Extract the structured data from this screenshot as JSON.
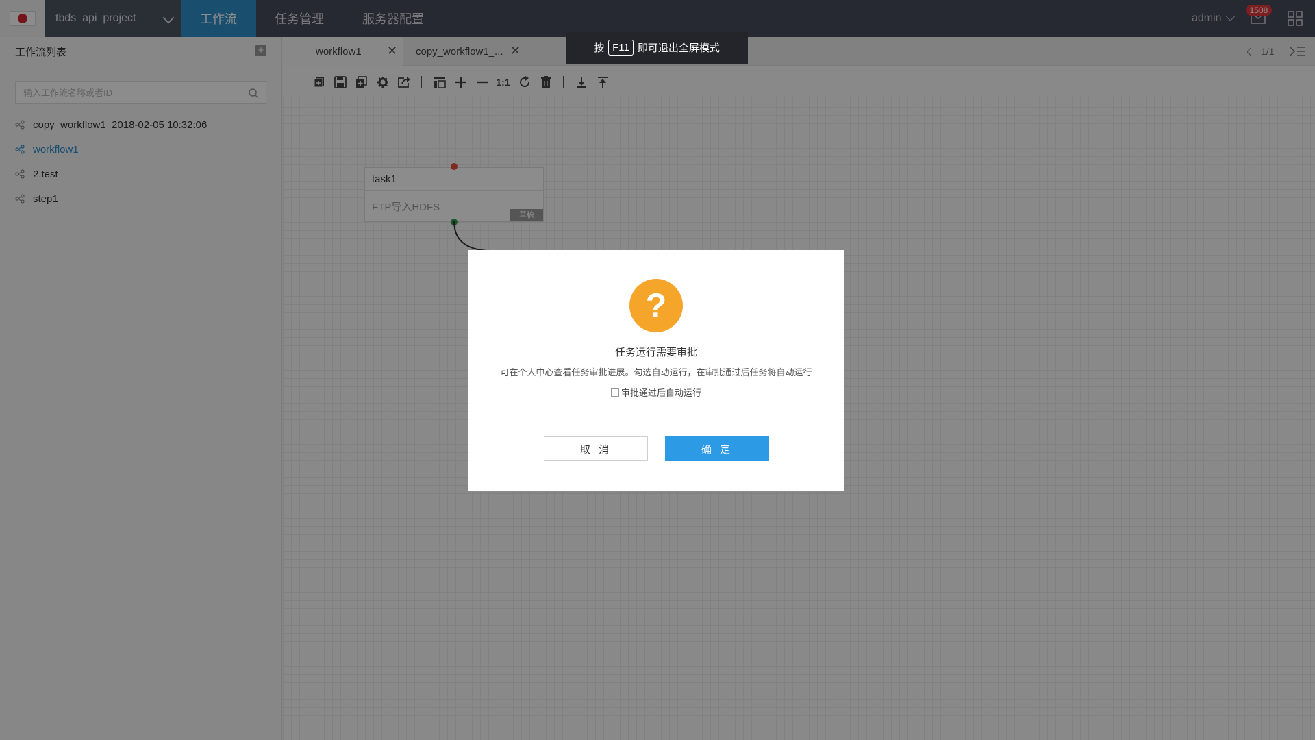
{
  "colors": {
    "nav_bg": "#464c5a",
    "nav_active": "#2f8fc9",
    "accent_blue": "#2d9ae6",
    "warning": "#f4a52a",
    "badge_red": "#e4393c"
  },
  "topbar": {
    "project": "tbds_api_project",
    "nav": [
      {
        "label": "工作流",
        "active": true
      },
      {
        "label": "任务管理",
        "active": false
      },
      {
        "label": "服务器配置",
        "active": false
      }
    ],
    "user": "admin",
    "mail_badge": "1508"
  },
  "sidebar": {
    "title": "工作流列表",
    "search_placeholder": "输入工作流名称或者ID",
    "items": [
      {
        "label": "copy_workflow1_2018-02-05 10:32:06",
        "active": false
      },
      {
        "label": "workflow1",
        "active": true
      },
      {
        "label": "2.test",
        "active": false
      },
      {
        "label": "step1",
        "active": false
      }
    ]
  },
  "tabs": [
    {
      "label": "workflow1",
      "active": true
    },
    {
      "label": "copy_workflow1_...",
      "active": false
    }
  ],
  "pager": "1/1",
  "toolbar_icons": [
    "add-icon",
    "save-icon",
    "copy-icon",
    "settings-icon",
    "export-icon",
    "layout-icon",
    "zoom-in-icon",
    "zoom-out-icon",
    "actual-size-icon",
    "refresh-icon",
    "delete-icon",
    "download-icon",
    "upload-icon"
  ],
  "toolbar": {
    "actual_size": "1:1"
  },
  "node": {
    "title": "task1",
    "desc": "FTP导入HDFS",
    "badge": "草稿"
  },
  "f11_banner": {
    "pre": "按",
    "key": "F11",
    "post": "即可退出全屏模式"
  },
  "modal": {
    "title": "任务运行需要审批",
    "text": "可在个人中心查看任务审批进展。勾选自动运行，在审批通过后任务将自动运行",
    "checkbox_label": "审批通过后自动运行",
    "cancel": "取 消",
    "ok": "确 定"
  }
}
